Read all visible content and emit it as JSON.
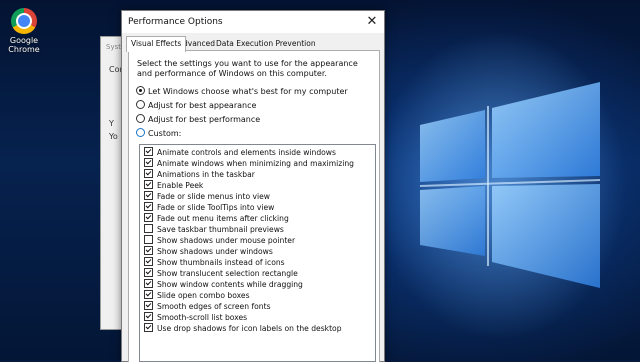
{
  "desktop": {
    "icons": [
      {
        "label_line1": "Google",
        "label_line2": "Chrome",
        "icon": "chrome-icon"
      }
    ]
  },
  "background_window": {
    "title": "Syste",
    "text1": "Com",
    "text2": "Y",
    "text3": "Yo"
  },
  "dialog": {
    "title": "Performance Options",
    "close_label": "✕",
    "tabs": [
      {
        "label": "Visual Effects",
        "active": true
      },
      {
        "label": "Advanced",
        "active": false
      },
      {
        "label": "Data Execution Prevention",
        "active": false
      }
    ],
    "description": "Select the settings you want to use for the appearance and performance of Windows on this computer.",
    "options": [
      {
        "label": "Let Windows choose what's best for my computer",
        "selected": true
      },
      {
        "label": "Adjust for best appearance",
        "selected": false
      },
      {
        "label": "Adjust for best performance",
        "selected": false
      },
      {
        "label": "Custom:",
        "selected": false
      }
    ],
    "effects": [
      {
        "label": "Animate controls and elements inside windows",
        "checked": true
      },
      {
        "label": "Animate windows when minimizing and maximizing",
        "checked": true
      },
      {
        "label": "Animations in the taskbar",
        "checked": true
      },
      {
        "label": "Enable Peek",
        "checked": true
      },
      {
        "label": "Fade or slide menus into view",
        "checked": true
      },
      {
        "label": "Fade or slide ToolTips into view",
        "checked": true
      },
      {
        "label": "Fade out menu items after clicking",
        "checked": true
      },
      {
        "label": "Save taskbar thumbnail previews",
        "checked": false
      },
      {
        "label": "Show shadows under mouse pointer",
        "checked": false
      },
      {
        "label": "Show shadows under windows",
        "checked": true
      },
      {
        "label": "Show thumbnails instead of icons",
        "checked": true
      },
      {
        "label": "Show translucent selection rectangle",
        "checked": true
      },
      {
        "label": "Show window contents while dragging",
        "checked": true
      },
      {
        "label": "Slide open combo boxes",
        "checked": true
      },
      {
        "label": "Smooth edges of screen fonts",
        "checked": true
      },
      {
        "label": "Smooth-scroll list boxes",
        "checked": true
      },
      {
        "label": "Use drop shadows for icon labels on the desktop",
        "checked": true
      }
    ]
  }
}
